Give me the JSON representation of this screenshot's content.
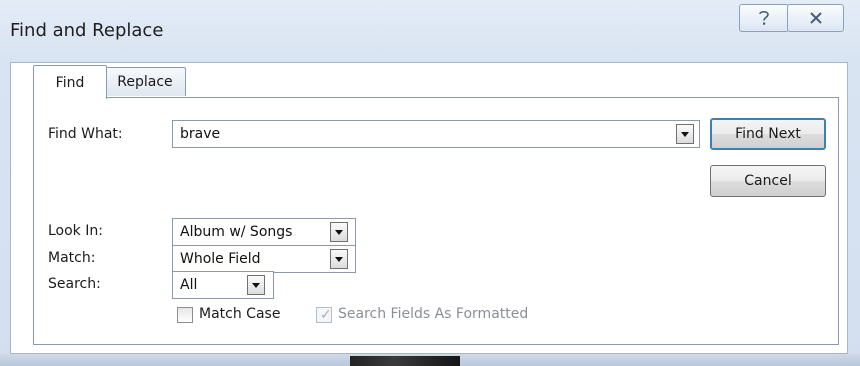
{
  "window": {
    "title": "Find and Replace",
    "help_icon": "question-icon",
    "close_icon": "close-icon"
  },
  "tabs": [
    {
      "label": "Find",
      "selected": true
    },
    {
      "label": "Replace",
      "selected": false
    }
  ],
  "form": {
    "find_what": {
      "label": "Find What:",
      "value": "brave"
    },
    "look_in": {
      "label": "Look In:",
      "value": "Album w/ Songs"
    },
    "match": {
      "label": "Match:",
      "value": "Whole Field"
    },
    "search": {
      "label": "Search:",
      "value": "All"
    },
    "match_case": {
      "label": "Match Case",
      "checked": false
    },
    "search_formatted": {
      "label": "Search Fields As Formatted",
      "checked": true,
      "enabled": false
    }
  },
  "buttons": {
    "find_next": "Find Next",
    "cancel": "Cancel"
  }
}
